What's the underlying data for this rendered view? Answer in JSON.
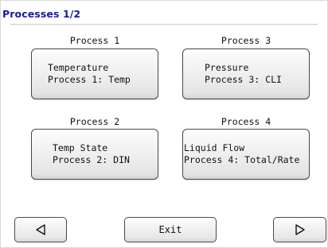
{
  "header": {
    "title": "Processes 1/2"
  },
  "processes": [
    {
      "heading": "Process 1",
      "line1": "Temperature",
      "line2": "Process 1: Temp"
    },
    {
      "heading": "Process 3",
      "line1": "Pressure",
      "line2": "Process 3: CLI"
    },
    {
      "heading": "Process 2",
      "line1": "Temp State",
      "line2": "Process 2: DIN"
    },
    {
      "heading": "Process 4",
      "line1": "Liquid Flow",
      "line2": "Process 4: Total/Rate"
    }
  ],
  "footer": {
    "prev_icon": "triangle-left-icon",
    "exit_label": "Exit",
    "next_icon": "triangle-right-icon"
  },
  "colors": {
    "title": "#1a1aa8",
    "button_border": "#4a4a4a",
    "background": "#ffffff"
  }
}
